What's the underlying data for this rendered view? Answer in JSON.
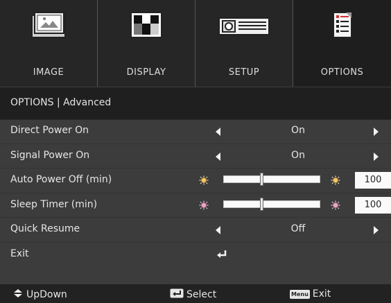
{
  "tabs": [
    {
      "label": "IMAGE",
      "icon": "image-icon"
    },
    {
      "label": "DISPLAY",
      "icon": "display-icon"
    },
    {
      "label": "SETUP",
      "icon": "projector-icon"
    },
    {
      "label": "OPTIONS",
      "icon": "options-checklist-icon",
      "active": true
    }
  ],
  "breadcrumb": "OPTIONS | Advanced",
  "rows": [
    {
      "label": "Direct Power On",
      "value": "On"
    },
    {
      "label": "Signal Power On",
      "value": "On"
    },
    {
      "label": "Auto Power Off (min)",
      "value": "100",
      "level": 0.39
    },
    {
      "label": "Sleep Timer (min)",
      "value": "100",
      "level": 0.39
    },
    {
      "label": "Quick Resume",
      "value": "Off"
    },
    {
      "label": "Exit"
    }
  ],
  "footer": {
    "updown": "UpDown",
    "select": "Select",
    "menu_key": "Menu",
    "exit": "Exit"
  },
  "colors": {
    "panel": "#3c3c3c",
    "tabbar": "#262626",
    "active_tab": "#1e1e1e",
    "text": "#e6e6e6"
  }
}
